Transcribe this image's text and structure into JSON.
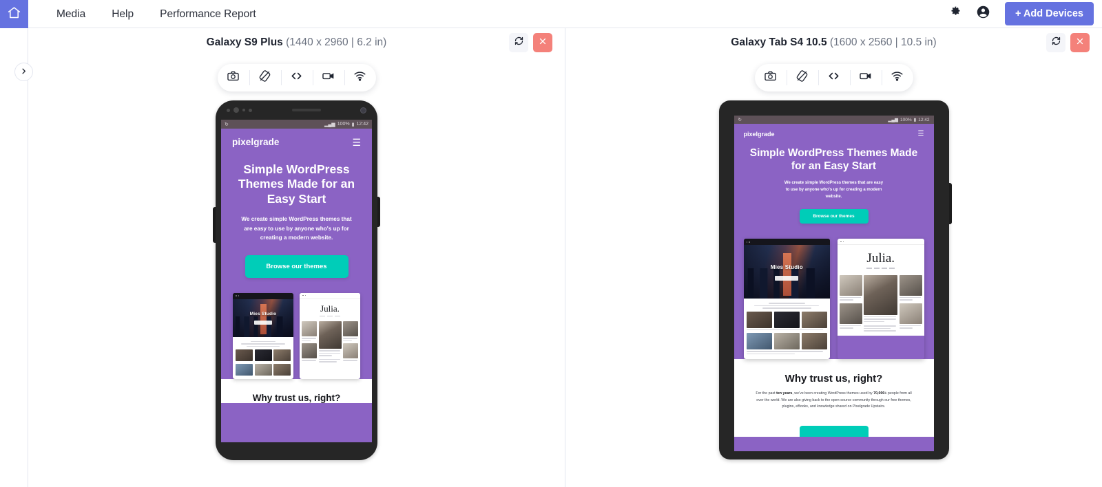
{
  "topbar": {
    "home_icon": "home-icon",
    "nav": [
      {
        "label": "Media"
      },
      {
        "label": "Help"
      },
      {
        "label": "Performance Report"
      }
    ],
    "settings_icon": "gear-icon",
    "account_icon": "account-circle-icon",
    "add_devices_label": "+ Add Devices",
    "accent_color": "#6572E0"
  },
  "rail": {
    "expand_icon": "chevron-right-icon"
  },
  "tools": [
    {
      "name": "screenshot-tool",
      "icon": "camera-icon"
    },
    {
      "name": "rotate-tool",
      "icon": "rotate-screen-icon"
    },
    {
      "name": "inspect-tool",
      "icon": "code-brackets-icon"
    },
    {
      "name": "record-tool",
      "icon": "video-camera-icon"
    },
    {
      "name": "network-tool",
      "icon": "wifi-icon"
    }
  ],
  "devices": [
    {
      "name": "Galaxy S9 Plus",
      "specs": "(1440 x 2960 | 6.2 in)",
      "refresh_icon": "refresh-icon",
      "close_icon": "close-icon",
      "close_color": "#F4817A",
      "status": {
        "time": "12:42",
        "battery": "100%",
        "signal_icon": "signal-bars-icon",
        "battery_icon": "battery-icon",
        "loading_icon": "spinner-icon"
      }
    },
    {
      "name": "Galaxy Tab S4 10.5",
      "specs": "(1600 x 2560 | 10.5 in)",
      "refresh_icon": "refresh-icon",
      "close_icon": "close-icon",
      "close_color": "#F4817A",
      "status": {
        "time": "12:42",
        "battery": "100%",
        "signal_icon": "signal-bars-icon",
        "battery_icon": "battery-icon",
        "loading_icon": "spinner-icon"
      }
    }
  ],
  "site": {
    "brand": "pixelgrade",
    "menu_icon": "hamburger-menu-icon",
    "hero_title": "Simple WordPress Themes Made for an Easy Start",
    "hero_sub": "We create simple WordPress themes that are easy to use by anyone who's up for creating a modern website.",
    "cta_label": "Browse our themes",
    "purple": "#8B63C4",
    "teal": "#00CDB8",
    "cards": [
      {
        "name": "Mies Studio",
        "style": "dark"
      },
      {
        "name": "Julia.",
        "style": "light"
      }
    ],
    "trust_title": "Why trust us, right?",
    "trust_text_1": "For the past ",
    "trust_bold_1": "ten years",
    "trust_text_2": ", we've been creating WordPress themes used by ",
    "trust_bold_2": "70,000+",
    "trust_text_3": " people from all over the world. We are also giving back to the open-source community through our free themes, plugins, eBooks, and knowledge shared on Pixelgrade Upstairs."
  }
}
